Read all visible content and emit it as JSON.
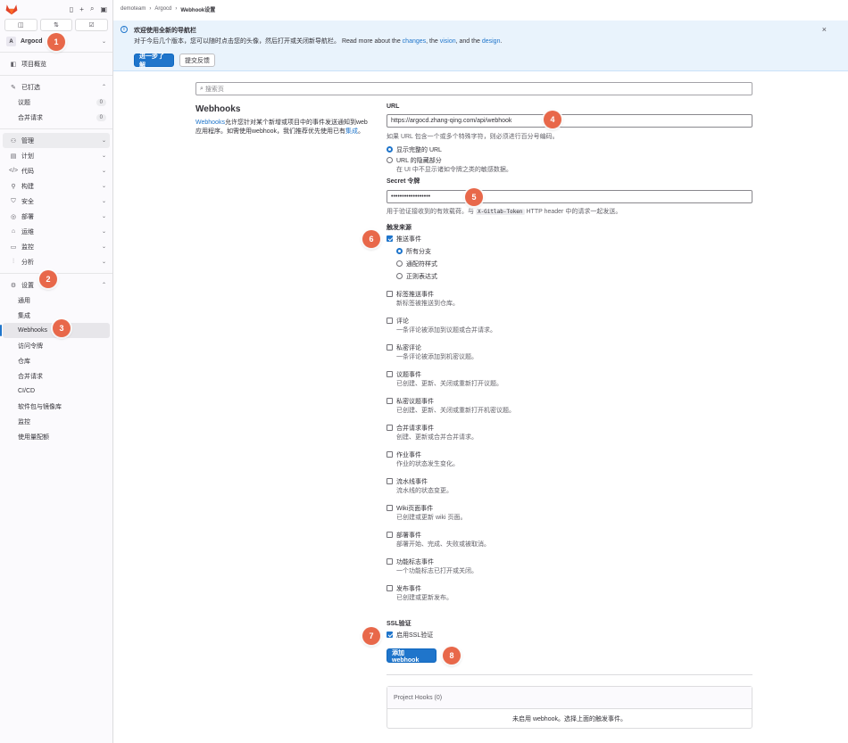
{
  "sidebar": {
    "project_avatar": "A",
    "project_name": "Argocd",
    "counter_icons": [
      "issues-icon",
      "merge-request-icon",
      "todo-icon"
    ],
    "items": {
      "overview": "项目概览",
      "pinned": "已钉选",
      "issues": "议题",
      "issues_count": "0",
      "mrs": "合并请求",
      "mrs_count": "0",
      "manage": "管理",
      "plan": "计划",
      "code": "代码",
      "build": "构建",
      "secure": "安全",
      "deploy": "部署",
      "operate": "运维",
      "monitor": "监控",
      "analyze": "分析",
      "settings": "设置"
    },
    "settings_sub": [
      "通用",
      "集成",
      "Webhooks",
      "访问令牌",
      "仓库",
      "合并请求",
      "CI/CD",
      "软件包与镜像库",
      "监控",
      "使用量配额"
    ]
  },
  "breadcrumb": [
    "demoteam",
    "Argocd",
    "Webhook设置"
  ],
  "banner": {
    "title": "欢迎使用全新的导航栏",
    "text_prefix": "对于今后几个版本，您可以随时点击您的头像，然后打开或关闭新导航栏。 Read more about the",
    "link_changes": "changes",
    "sep1": ", the",
    "link_vision": "vision",
    "sep2": ", and the",
    "link_design": "design",
    "end": ".",
    "learn_more": "进一步了解",
    "feedback": "提交反馈",
    "close": "×"
  },
  "search": {
    "placeholder": "搜索页"
  },
  "intro": {
    "title": "Webhooks",
    "link_webhooks": "Webhooks",
    "desc1": "允许您针对某个新增或项目中的事件发送通知到web应用程序。如需使用webhook，我们推荐优先使用已有",
    "link_integrations": "集成",
    "desc_end": "。"
  },
  "form": {
    "url_label": "URL",
    "url_value": "https://argocd.zhang-qing.com/api/webhook",
    "url_help": "如果 URL 包含一个或多个特殊字符，则必须进行百分号编码。",
    "url_show_full": "显示完整的 URL",
    "url_mask": "URL 的隐藏部分",
    "url_mask_help": "在 UI 中不显示诸如令牌之类的敏感数据。",
    "secret_label": "Secret 令牌",
    "secret_value": "••••••••••••••••••",
    "secret_help_1": "用于验证接收到的有效载荷。与",
    "secret_header": "X-Gitlab-Token",
    "secret_help_2": "HTTP header 中的请求一起发送。",
    "trigger_label": "触发来源",
    "push_events": "推送事件",
    "all_branches": "所有分支",
    "wildcard": "通配符样式",
    "regex": "正则表达式",
    "events": [
      {
        "label": "标签推送事件",
        "desc": "新标签被推送到仓库。"
      },
      {
        "label": "评论",
        "desc": "一条评论被添加到议题或合并请求。"
      },
      {
        "label": "私密评论",
        "desc": "一条评论被添加到机密议题。"
      },
      {
        "label": "议题事件",
        "desc": "已创建、更新、关闭或重新打开议题。"
      },
      {
        "label": "私密议题事件",
        "desc": "已创建、更新、关闭或重新打开机密议题。"
      },
      {
        "label": "合并请求事件",
        "desc": "创建、更新或合并合并请求。"
      },
      {
        "label": "作业事件",
        "desc": "作业的状态发生变化。"
      },
      {
        "label": "流水线事件",
        "desc": "流水线的状态变更。"
      },
      {
        "label": "Wiki页面事件",
        "desc": "已创建或更新 wiki 页面。"
      },
      {
        "label": "部署事件",
        "desc": "部署开始、完成、失败或被取消。"
      },
      {
        "label": "功能标志事件",
        "desc": "一个功能标志已打开或关闭。"
      },
      {
        "label": "发布事件",
        "desc": "已创建或更新发布。"
      }
    ],
    "ssl_label": "SSL验证",
    "ssl_enable": "启用SSL验证",
    "add_button": "添加webhook"
  },
  "project_hooks": {
    "header": "Project Hooks (0)",
    "empty": "未启用 webhook。选择上面的触发事件。"
  },
  "markers": [
    "1",
    "2",
    "3",
    "4",
    "5",
    "6",
    "7",
    "8"
  ],
  "colors": {
    "accent": "#1f75cb",
    "marker": "#e8684a",
    "banner_bg": "#e9f3fc",
    "sidebar_bg": "#fbfafd"
  }
}
